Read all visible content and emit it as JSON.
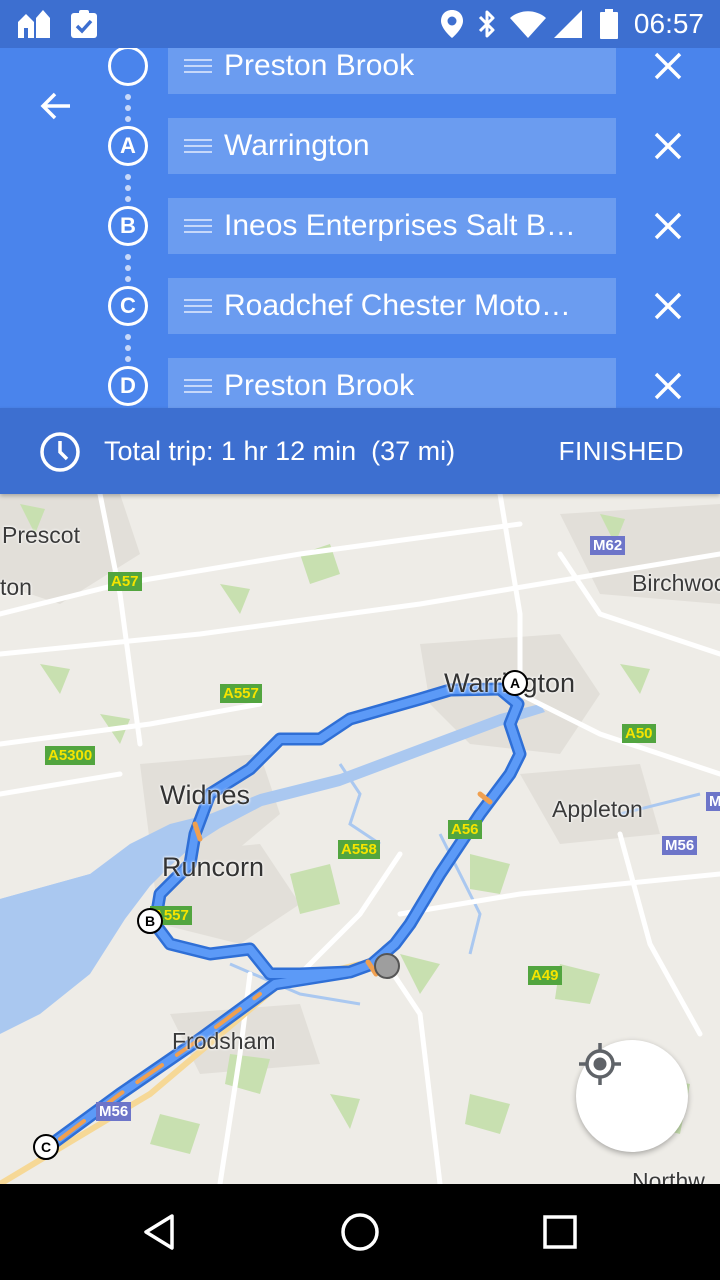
{
  "status_bar": {
    "time": "06:57",
    "icons": [
      "home-app-icon",
      "clipboard-check-icon",
      "location-icon",
      "bluetooth-icon",
      "wifi-icon",
      "cell-signal-icon",
      "battery-icon"
    ]
  },
  "directions": {
    "back_icon": "arrow-back-icon",
    "stops": [
      {
        "marker": "",
        "name": "Preston Brook"
      },
      {
        "marker": "A",
        "name": "Warrington"
      },
      {
        "marker": "B",
        "name": "Ineos Enterprises Salt B…"
      },
      {
        "marker": "C",
        "name": "Roadchef Chester Moto…"
      },
      {
        "marker": "D",
        "name": "Preston Brook"
      }
    ],
    "remove_icon": "close-icon",
    "drag_icon": "drag-handle-icon"
  },
  "trip": {
    "summary": "Total trip: 1 hr 12 min  (37 mi)",
    "finished_label": "FINISHED",
    "clock_icon": "clock-icon"
  },
  "map": {
    "places": [
      {
        "id": "prescot",
        "text": "Prescot"
      },
      {
        "id": "ton",
        "text": "ton"
      },
      {
        "id": "birchwood",
        "text": "Birchwoo"
      },
      {
        "id": "warrington",
        "text": "Warrington"
      },
      {
        "id": "widnes",
        "text": "Widnes"
      },
      {
        "id": "appleton",
        "text": "Appleton"
      },
      {
        "id": "runcorn",
        "text": "Runcorn"
      },
      {
        "id": "frodsham",
        "text": "Frodsham"
      },
      {
        "id": "northwich",
        "text": "Northw"
      }
    ],
    "road_shields": [
      "A57",
      "M62",
      "A557",
      "A5300",
      "A50",
      "A56",
      "M56",
      "A558",
      "A557",
      "A49",
      "M56",
      "M"
    ],
    "pins": [
      "A",
      "B",
      "C"
    ],
    "colors": {
      "route": "#4a8af4",
      "route_border": "#2f6fd6",
      "water": "#aac8f0",
      "park": "#c8e0b0",
      "traffic": "#f0a050"
    },
    "locate_icon": "my-location-icon"
  },
  "nav": {
    "icons": [
      "back-triangle-icon",
      "home-circle-icon",
      "recents-square-icon"
    ]
  }
}
